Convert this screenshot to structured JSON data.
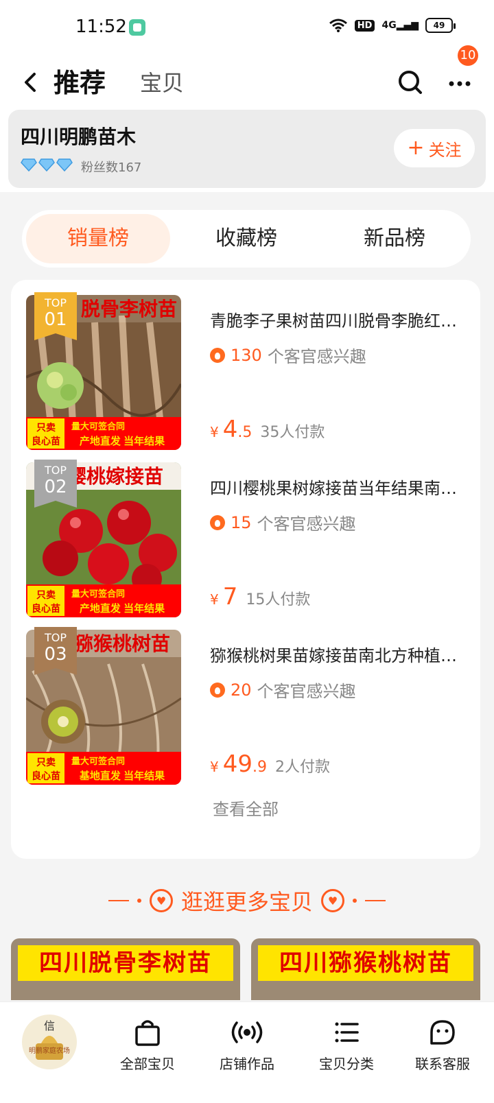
{
  "status_bar": {
    "time": "11:52",
    "hd": "HD",
    "signal": "4G",
    "battery": "49"
  },
  "header": {
    "title": "推荐",
    "secondary_tab": "宝贝",
    "notification_count": "10"
  },
  "shop": {
    "name": "四川明鹏苗木",
    "fans": "粉丝数167",
    "follow_label": "关注"
  },
  "rank_tabs": [
    {
      "label": "销量榜",
      "active": true
    },
    {
      "label": "收藏榜",
      "active": false
    },
    {
      "label": "新品榜",
      "active": false
    }
  ],
  "products": [
    {
      "rank_top": "TOP",
      "rank_num": "01",
      "title": "青脆李子果树苗四川脱骨李脆红…",
      "interest_count": "130",
      "interest_text": "个客官感兴趣",
      "price_symbol": "¥",
      "price_int": "4",
      "price_dec": ".5",
      "paid": "35人付款",
      "img_banner": "脱骨李树苗",
      "img_tag1": "只卖",
      "img_tag2": "良心苗",
      "img_slogan1": "量大可签合同",
      "img_slogan2": "产地直发 当年结果"
    },
    {
      "rank_top": "TOP",
      "rank_num": "02",
      "title": "四川樱桃果树嫁接苗当年结果南…",
      "interest_count": "15",
      "interest_text": "个客官感兴趣",
      "price_symbol": "¥",
      "price_int": "7",
      "price_dec": "",
      "paid": "15人付款",
      "img_banner": "樱桃嫁接苗",
      "img_tag1": "只卖",
      "img_tag2": "良心苗",
      "img_slogan1": "量大可签合同",
      "img_slogan2": "产地直发 当年结果"
    },
    {
      "rank_top": "TOP",
      "rank_num": "03",
      "title": "猕猴桃树果苗嫁接苗南北方种植…",
      "interest_count": "20",
      "interest_text": "个客官感兴趣",
      "price_symbol": "¥",
      "price_int": "49",
      "price_dec": ".9",
      "paid": "2人付款",
      "img_banner": "猕猴桃树苗",
      "img_tag1": "只卖",
      "img_tag2": "良心苗",
      "img_slogan1": "量大可签合同",
      "img_slogan2": "基地直发 当年结果"
    }
  ],
  "view_all": "查看全部",
  "explore_more": "逛逛更多宝贝",
  "more_cards": [
    {
      "banner": "四川脱骨李树苗"
    },
    {
      "banner": "四川猕猴桃树苗"
    }
  ],
  "bottom_nav": {
    "logo_text": "明鹏家庭农场",
    "items": [
      {
        "label": "全部宝贝",
        "icon": "bag-icon"
      },
      {
        "label": "店铺作品",
        "icon": "broadcast-icon"
      },
      {
        "label": "宝贝分类",
        "icon": "list-icon"
      },
      {
        "label": "联系客服",
        "icon": "chat-face-icon"
      }
    ]
  },
  "colors": {
    "accent": "#ff5a1f",
    "gold": "#f2b431",
    "silver": "#a7a7a7",
    "bronze": "#a87c53"
  }
}
